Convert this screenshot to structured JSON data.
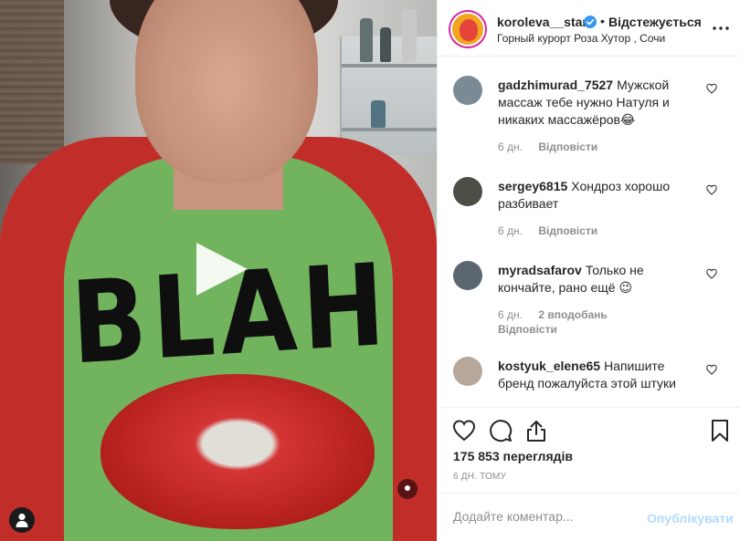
{
  "post": {
    "owner": "koroleva__star",
    "separator": "•",
    "follow_status": "Відстежується",
    "location": "Горный курорт Роза Хутор , Сочи",
    "views": "175 853 переглядів",
    "timestamp": "6 ДН. ТОМУ"
  },
  "comments": [
    {
      "user": "gadzhimurad_7527",
      "text": "Мужской массаж тебе нужно Натуля и никаких массажёров😂",
      "age": "6 дн.",
      "reply": "Відповісти",
      "avatar_color": "#7b8a94"
    },
    {
      "user": "sergey6815",
      "text": "Хондроз хорошо разбивает",
      "age": "6 дн.",
      "reply": "Відповісти",
      "avatar_color": "#4d4f47"
    },
    {
      "user": "myradsafarov",
      "text": "Только не кончайте, рано ещё 😉",
      "age": "6 дн.",
      "likes": "2 вподобань",
      "reply": "Відповісти",
      "avatar_color": "#5c6670"
    },
    {
      "user": "kostyuk_elene65",
      "text": "Напишите бренд пожалуйста этой штуки",
      "avatar_color": "#b7a79a"
    }
  ],
  "comment_form": {
    "placeholder": "Додайте коментар...",
    "publish_label": "Опублікувати"
  },
  "icons": {
    "verified": "verified-badge-icon",
    "more": "more-options-icon",
    "like": "heart-icon",
    "comment": "comment-bubble-icon",
    "share": "share-icon",
    "save": "bookmark-icon",
    "play": "play-icon",
    "user_tag": "user-tag-icon"
  },
  "colors": {
    "accent": "#0095f6",
    "publish_disabled": "#b3dbff",
    "verified": "#3897f0",
    "meta_text": "#8e8e8e"
  }
}
